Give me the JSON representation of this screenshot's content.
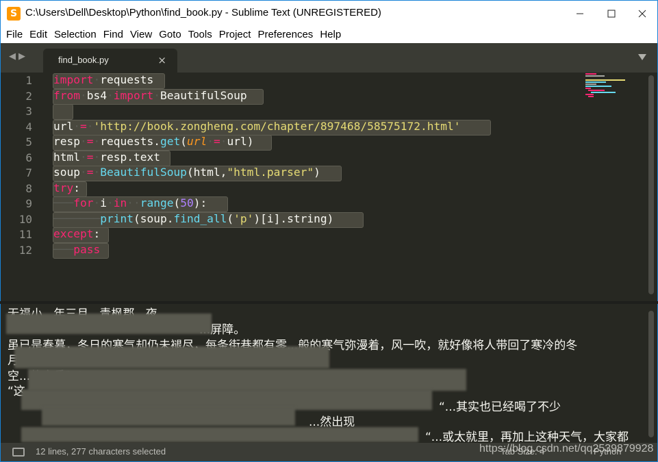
{
  "window": {
    "title": "C:\\Users\\Dell\\Desktop\\Python\\find_book.py - Sublime Text (UNREGISTERED)",
    "icon": "sublime-text-icon",
    "controls": [
      "minimize",
      "maximize",
      "close"
    ]
  },
  "menu": [
    "File",
    "Edit",
    "Selection",
    "Find",
    "View",
    "Goto",
    "Tools",
    "Project",
    "Preferences",
    "Help"
  ],
  "tab": {
    "label": "find_book.py",
    "close": "×"
  },
  "line_numbers": [
    "1",
    "2",
    "3",
    "4",
    "5",
    "6",
    "7",
    "8",
    "9",
    "10",
    "11",
    "12"
  ],
  "code": {
    "l1": {
      "kw": "import",
      "rest": "requests"
    },
    "l2": {
      "kw1": "from",
      "mod": "bs4",
      "kw2": "import",
      "rest": "BeautifulSoup"
    },
    "l4": {
      "var": "url",
      "op": "=",
      "str": "'http://book.zongheng.com/chapter/897468/58575172.html'"
    },
    "l5": {
      "var": "resp",
      "op": "=",
      "obj": "requests.",
      "fn": "get",
      "p1": "(",
      "arg": "url",
      "op2": "=",
      "val": "url)"
    },
    "l6": {
      "var": "html",
      "op": "=",
      "rest": "resp.text"
    },
    "l7": {
      "var": "soup",
      "op": "=",
      "fn": "BeautifulSoup",
      "p1": "(html,",
      "str": "\"html.parser\"",
      "p2": ")"
    },
    "l8": {
      "kw": "try",
      "rest": ":"
    },
    "l9": {
      "kw1": "for",
      "v": "i",
      "kw2": "in",
      "fn": "range",
      "p1": "(",
      "num": "50",
      "p2": "):"
    },
    "l10": {
      "fn": "print",
      "p1": "(soup.",
      "fn2": "find_all",
      "p2": "(",
      "str": "'p'",
      "p3": ")[i].string)"
    },
    "l11": {
      "kw": "except",
      "rest": ":"
    },
    "l12": {
      "kw": "pass"
    }
  },
  "output": [
    "无福小...年三月...青枫郡...夜",
    "...屏障。",
    "虽已是春暮，冬日的寒气却仍未褪尽，每条街巷都有零...般的寒气弥漫着，风一吹，就好像将人带回了寒冷的冬",
    "月",
    "空...的士兵？！",
    "“这...",
    "“...其实也已经喝了不少",
    "...然出现",
    "“...或太就里，再加上这种天气，大家都"
  ],
  "status": {
    "selection": "12 lines, 277 characters selected",
    "tab_size": "Tab Size: 4",
    "syntax": "Python",
    "watermark": "https://blog.csdn.net/qq2539879928"
  },
  "colors": {
    "background": "#272822",
    "keyword": "#f92672",
    "function": "#66d9ef",
    "string": "#e6db74",
    "number": "#ae81ff",
    "argument": "#fd971f",
    "selection": "#49483e"
  }
}
